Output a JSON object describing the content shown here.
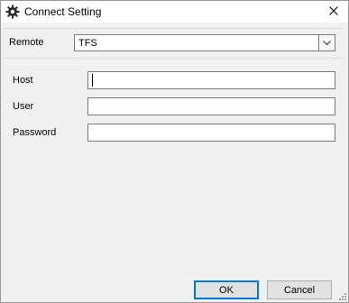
{
  "window": {
    "title": "Connect Setting",
    "icon": "gear-icon",
    "close_icon": "close-icon"
  },
  "remote": {
    "label": "Remote",
    "selected": "TFS",
    "arrow_icon": "chevron-down-icon"
  },
  "fields": {
    "host": {
      "label": "Host",
      "value": ""
    },
    "user": {
      "label": "User",
      "value": ""
    },
    "password": {
      "label": "Password",
      "value": ""
    }
  },
  "buttons": {
    "ok": "OK",
    "cancel": "Cancel"
  },
  "colors": {
    "window_bg": "#f0f0f0",
    "titlebar_bg": "#ffffff",
    "default_button_border": "#0078d7"
  }
}
